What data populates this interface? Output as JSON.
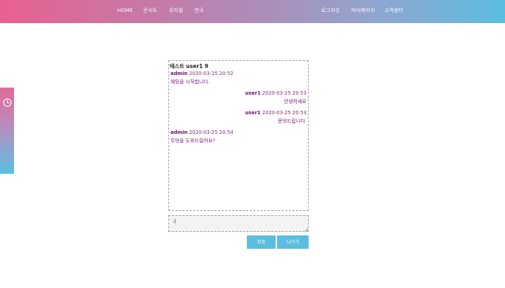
{
  "header": {
    "nav_left": [
      "HOME",
      "콘서트",
      "뮤지컬",
      "연극"
    ],
    "nav_right": [
      "로그아웃",
      "마이페이지",
      "고객센터"
    ],
    "gradient_colors": [
      "#e8608f",
      "#b487b3",
      "#5bbde0"
    ]
  },
  "side_tab": {
    "icon": "clock-icon"
  },
  "chat": {
    "room_title": "테스트 user1 9",
    "messages": [
      {
        "user": "admin",
        "time": "2020-03-25 20:52",
        "text": "채팅을  시작합니다.",
        "align": "left"
      },
      {
        "user": "user1",
        "time": "2020-03-25 20:53",
        "text": "안녕하세요",
        "align": "right"
      },
      {
        "user": "user1",
        "time": "2020-03-25 20:53",
        "text": "문의드립니다.",
        "align": "right"
      },
      {
        "user": "admin",
        "time": "2020-03-25 20:54",
        "text": "무엇을  도와드릴까요?",
        "align": "left"
      }
    ],
    "message_color": "#7a1a7a"
  },
  "input": {
    "value": ":)"
  },
  "buttons": {
    "send_label": "전송",
    "exit_label": "나가기",
    "color": "#5bbde0"
  }
}
